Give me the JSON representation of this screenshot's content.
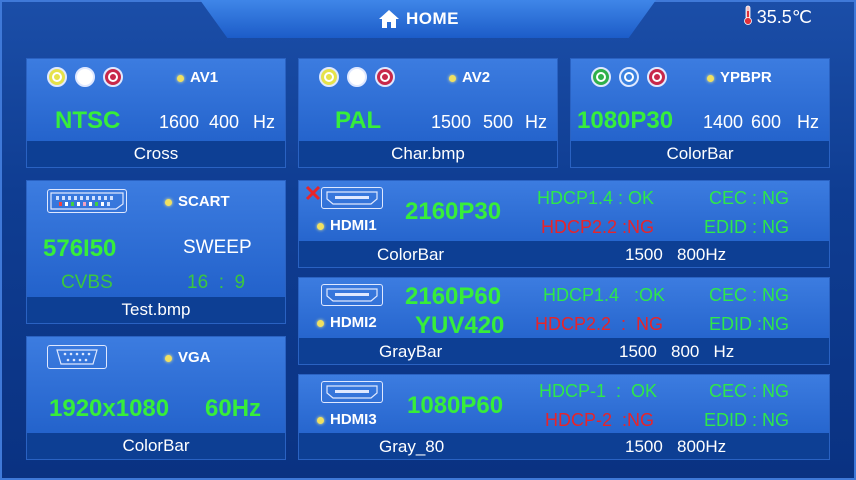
{
  "header": {
    "title": "HOME",
    "icon": "home-icon",
    "temperature": "35.5℃"
  },
  "av1": {
    "label": "AV1",
    "format": "NTSC",
    "hfreq": "1600",
    "vfreq": "400",
    "unit": "Hz",
    "pattern": "Cross",
    "jack_colors": [
      "#e6e24a",
      "#ffffff",
      "#c8284a"
    ]
  },
  "av2": {
    "label": "AV2",
    "format": "PAL",
    "hfreq": "1500",
    "vfreq": "500",
    "unit": "Hz",
    "pattern": "Char.bmp",
    "jack_colors": [
      "#e6e24a",
      "#ffffff",
      "#c8284a"
    ]
  },
  "ypbpr": {
    "label": "YPBPR",
    "format": "1080P30",
    "hfreq": "1400",
    "vfreq": "600",
    "unit": "Hz",
    "pattern": "ColorBar",
    "jack_colors": [
      "#2fb04a",
      "#3b82e0",
      "#c8284a"
    ]
  },
  "scart": {
    "label": "SCART",
    "format": "576I50",
    "mode": "SWEEP",
    "signal": "CVBS",
    "aspect_w": "16",
    "aspect_sep": ":",
    "aspect_h": "9",
    "pattern": "Test.bmp"
  },
  "vga": {
    "label": "VGA",
    "resolution": "1920x1080",
    "rate": "60Hz",
    "pattern": "ColorBar"
  },
  "hdmi1": {
    "label": "HDMI1",
    "format": "2160P30",
    "hdcp_a": "HDCP1.4  :  OK",
    "hdcp_b": "HDCP2.2  :NG",
    "cec": "CEC  :  NG",
    "edid": "EDID  :  NG",
    "pattern": "ColorBar",
    "freq": "1500   800Hz",
    "disconnected": true
  },
  "hdmi2": {
    "label": "HDMI2",
    "format": "2160P60",
    "format2": "YUV420",
    "hdcp_a": "HDCP1.4   :OK",
    "hdcp_b": "HDCP2.2  :  NG",
    "cec": "CEC  :  NG",
    "edid": "EDID  :NG",
    "pattern": "GrayBar",
    "freq": "1500   800   Hz"
  },
  "hdmi3": {
    "label": "HDMI3",
    "format": "1080P60",
    "hdcp_a": "HDCP-1  :  OK",
    "hdcp_b": "HDCP-2  :NG",
    "cec": "CEC  :  NG",
    "edid": "EDID  :  NG",
    "pattern": "Gray_80",
    "freq": "1500   800Hz"
  }
}
